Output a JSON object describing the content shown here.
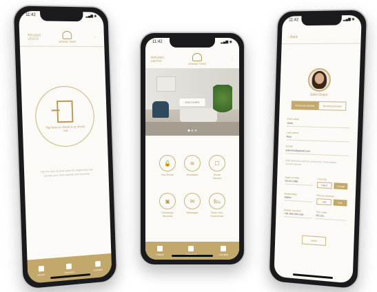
{
  "left_phone": {
    "time": "11:42",
    "header_left": "RIFUGIO\nLECCO",
    "brand_name": "GRAND TREE",
    "door_text": "Tap here to check in or check out",
    "description": "Tap the door icon to open the digital key and access your room quickly and securely.",
    "tabs": [
      {
        "label": "Home"
      },
      {
        "label": "Check-in"
      },
      {
        "label": "Contact"
      }
    ]
  },
  "center_phone": {
    "time": "11:42",
    "header_left": "RIFUGIO\nLECCO",
    "brand_name": "GRAND TREE",
    "hero_button": "DISCOVER",
    "services": [
      {
        "icon": "🔓",
        "label": "Key Room"
      },
      {
        "icon": "≋",
        "label": "Breakfast"
      },
      {
        "icon": "☐",
        "label": "Room\nService"
      },
      {
        "icon": "▣",
        "label": "Concierge\nServices"
      },
      {
        "icon": "✉",
        "label": "Messages"
      },
      {
        "icon": "🛏",
        "label": "Book Your\nExperience"
      }
    ],
    "tabs": [
      {
        "label": "Home"
      },
      {
        "label": "Check-in"
      },
      {
        "label": "Contact"
      }
    ]
  },
  "right_phone": {
    "time": "11:42",
    "back": "‹ Back",
    "user_name": "Jules Grace",
    "tabs": [
      "Personal Details",
      "Booking Details"
    ],
    "fields": [
      {
        "label": "First name",
        "value": "Jules"
      },
      {
        "label": "Last name",
        "value": "Rice"
      },
      {
        "label": "Email",
        "value": "julesrice@gmail.com"
      },
      {
        "label": "",
        "value": "Mail address used to send your reservation confirmations"
      }
    ],
    "pairs": [
      {
        "left_label": "Date of birth",
        "left_value": "05.04.1986",
        "right_label": "Country",
        "right_box": "ITALY",
        "right_btn": "Change"
      },
      {
        "left_label": "Nationality",
        "left_value": "Italian",
        "right_label": "Phone number",
        "right_box": "+39",
        "right_btn": "Edit"
      },
      {
        "left_label": "Mobile number",
        "left_value": "+39 348 284 234",
        "right_label": "Tax code",
        "right_box": "RCJ11",
        "right_btn": ""
      }
    ],
    "save_label": "Save"
  }
}
